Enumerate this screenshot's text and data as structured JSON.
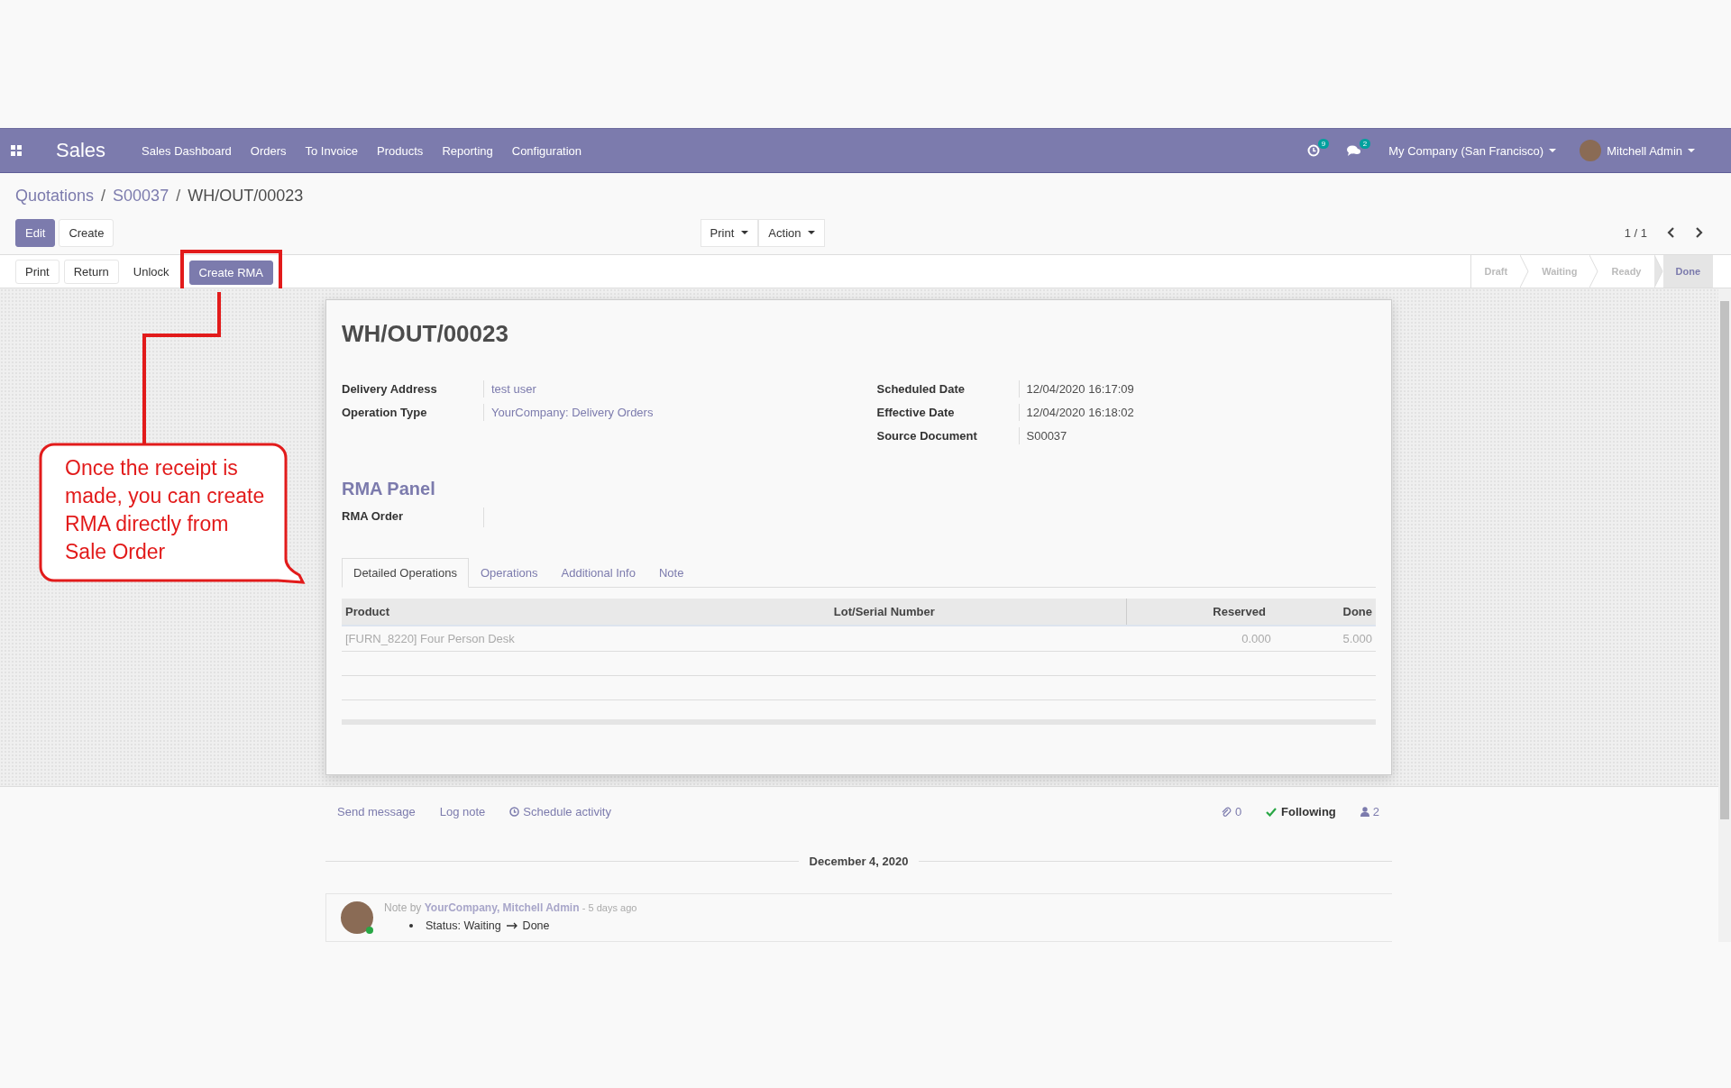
{
  "app": {
    "name": "Sales",
    "menu": [
      "Sales Dashboard",
      "Orders",
      "To Invoice",
      "Products",
      "Reporting",
      "Configuration"
    ],
    "activity_count": "9",
    "message_count": "2",
    "company": "My Company (San Francisco)",
    "user": "Mitchell Admin"
  },
  "breadcrumb": [
    {
      "label": "Quotations",
      "kind": "link"
    },
    {
      "label": "S00037",
      "kind": "link"
    },
    {
      "label": "WH/OUT/00023",
      "kind": "current"
    }
  ],
  "breadcrumb_separator": "/",
  "main_buttons": [
    {
      "label": "Edit",
      "kind": "primary"
    },
    {
      "label": "Create",
      "kind": "secondary"
    }
  ],
  "dropdowns": [
    "Print",
    "Action"
  ],
  "pager": "1 / 1",
  "header_buttons": [
    {
      "label": "Print",
      "kind": "secondary",
      "highlighted": false
    },
    {
      "label": "Return",
      "kind": "secondary",
      "highlighted": false
    },
    {
      "label": "Unlock",
      "kind": "plain",
      "highlighted": false
    },
    {
      "label": "Create RMA",
      "kind": "primary",
      "highlighted": true
    }
  ],
  "stages": [
    {
      "label": "Draft",
      "selected": false
    },
    {
      "label": "Waiting",
      "selected": false
    },
    {
      "label": "Ready",
      "selected": false
    },
    {
      "label": "Done",
      "selected": true
    }
  ],
  "record": {
    "title": "WH/OUT/00023",
    "left_fields": [
      {
        "label": "Delivery Address",
        "value": "test user",
        "kind": "link"
      },
      {
        "label": "Operation Type",
        "value": "YourCompany: Delivery Orders",
        "kind": "link"
      }
    ],
    "right_fields": [
      {
        "label": "Scheduled Date",
        "value": "12/04/2020 16:17:09",
        "kind": "text"
      },
      {
        "label": "Effective Date",
        "value": "12/04/2020 16:18:02",
        "kind": "text"
      },
      {
        "label": "Source Document",
        "value": "S00037",
        "kind": "text"
      }
    ]
  },
  "rma_panel": {
    "title": "RMA Panel",
    "fields": [
      {
        "label": "RMA Order"
      }
    ]
  },
  "tabs": [
    {
      "label": "Detailed Operations",
      "selected": true
    },
    {
      "label": "Operations",
      "selected": false
    },
    {
      "label": "Additional Info",
      "selected": false
    },
    {
      "label": "Note",
      "selected": false
    }
  ],
  "table": {
    "columns": [
      "Product",
      "Lot/Serial Number",
      "Reserved",
      "Done"
    ],
    "rows": [
      {
        "product": "[FURN_8220] Four Person Desk",
        "reserved": "0.000",
        "done": "5.000"
      }
    ]
  },
  "chatter": {
    "actions": [
      {
        "label": "Send message",
        "kind": "plain"
      },
      {
        "label": "Log note",
        "kind": "plain"
      },
      {
        "label": "Schedule activity",
        "kind": "clock"
      }
    ],
    "attachments": "0",
    "following": "Following",
    "followers": "2",
    "date": "December 4, 2020",
    "messages": [
      {
        "prefix": "Note by",
        "author": "YourCompany, Mitchell Admin",
        "time": "- 5 days ago",
        "changes": [
          {
            "field": "Status:",
            "old": "Waiting",
            "new": "Done"
          }
        ]
      }
    ]
  },
  "callout": {
    "text": "Once the receipt is made, you can create RMA directly from Sale Order"
  }
}
